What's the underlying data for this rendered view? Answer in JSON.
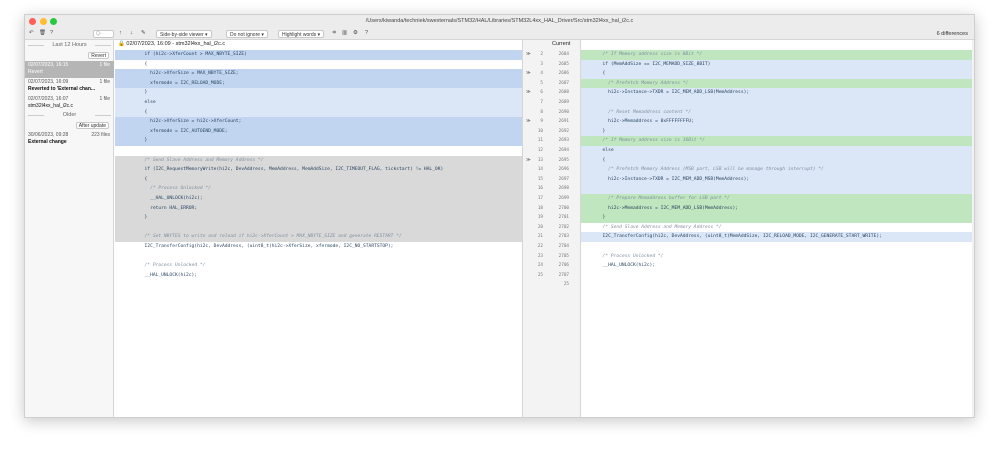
{
  "window": {
    "path": "/Users/kiwanda/techniek/swexternals/STM32/HAL/Libraries/STM32L4xx_HAL_Driver/Src/stm32l4xx_hal_i2c.c"
  },
  "toolbar": {
    "viewer": "Side-by-side viewer",
    "ignore": "Do not ignore",
    "highlight": "Highlight words",
    "search_placeholder": "Q-",
    "help": "?",
    "differences": "6 differences"
  },
  "sidebar": {
    "group_recent": "Last 12 Hours",
    "group_older": "Older",
    "revert_label": "Revert",
    "after_update_label": "After update",
    "entries": [
      {
        "date": "02/07/2023, 16:15",
        "files": "1 file",
        "message": "Revert"
      },
      {
        "date": "02/07/2023, 16:09",
        "files": "1 file",
        "message": "Reverted to 'External chan..."
      },
      {
        "date": "02/07/2023, 16:07",
        "files": "1 file",
        "message": "stm32l4xx_hal_i2c.c"
      },
      {
        "date": "30/06/2023, 09:28",
        "files": "223 files",
        "message": "External change"
      }
    ]
  },
  "left": {
    "header": "02/07/2023, 16:09 - stm32l4xx_hal_i2c.c",
    "lines": [
      "  if (hi2c->XferCount > MAX_NBYTE_SIZE)",
      "  {",
      "    hi2c->XferSize = MAX_NBYTE_SIZE;",
      "    xfermode = I2C_RELOAD_MODE;",
      "  }",
      "  else",
      "  {",
      "    hi2c->XferSize = hi2c->XferCount;",
      "    xfermode = I2C_AUTOEND_MODE;",
      "  }",
      "",
      "  /* Send Slave Address and Memory Address */",
      "  if (I2C_RequestMemoryWrite(hi2c, DevAddress, MemAddress, MemAddSize, I2C_TIMEOUT_FLAG, tickstart) != HAL_OK)",
      "  {",
      "    /* Process Unlocked */",
      "    __HAL_UNLOCK(hi2c);",
      "    return HAL_ERROR;",
      "  }",
      "",
      "  /* Set NBYTES to write and reload if hi2c->XferCount > MAX_NBYTE_SIZE and generate RESTART */",
      "  I2C_TransferConfig(hi2c, DevAddress, (uint8_t)hi2c->XferSize, xfermode, I2C_NO_STARTSTOP);",
      "",
      "  /* Process Unlocked */",
      "  __HAL_UNLOCK(hi2c);",
      ""
    ]
  },
  "gutter": {
    "header": "Current",
    "rows": [
      {
        "arrow": "≫",
        "left": "2",
        "right": "2684"
      },
      {
        "arrow": "",
        "left": "3",
        "right": "2685"
      },
      {
        "arrow": "≫",
        "left": "4",
        "right": "2686"
      },
      {
        "arrow": "",
        "left": "5",
        "right": "2687"
      },
      {
        "arrow": "≫",
        "left": "6",
        "right": "2688"
      },
      {
        "arrow": "",
        "left": "7",
        "right": "2689"
      },
      {
        "arrow": "",
        "left": "8",
        "right": "2690"
      },
      {
        "arrow": "≫",
        "left": "9",
        "right": "2691"
      },
      {
        "arrow": "",
        "left": "10",
        "right": "2692"
      },
      {
        "arrow": "",
        "left": "11",
        "right": "2693"
      },
      {
        "arrow": "",
        "left": "12",
        "right": "2694"
      },
      {
        "arrow": "≫",
        "left": "13",
        "right": "2695"
      },
      {
        "arrow": "",
        "left": "14",
        "right": "2696"
      },
      {
        "arrow": "",
        "left": "15",
        "right": "2697"
      },
      {
        "arrow": "",
        "left": "16",
        "right": "2698"
      },
      {
        "arrow": "",
        "left": "17",
        "right": "2699"
      },
      {
        "arrow": "",
        "left": "18",
        "right": "2700"
      },
      {
        "arrow": "",
        "left": "19",
        "right": "2701"
      },
      {
        "arrow": "",
        "left": "20",
        "right": "2702"
      },
      {
        "arrow": "",
        "left": "21",
        "right": "2703"
      },
      {
        "arrow": "",
        "left": "22",
        "right": "2704"
      },
      {
        "arrow": "",
        "left": "23",
        "right": "2705"
      },
      {
        "arrow": "",
        "left": "24",
        "right": "2706"
      },
      {
        "arrow": "",
        "left": "25",
        "right": "2707"
      },
      {
        "arrow": "",
        "left": "",
        "right": "25"
      }
    ]
  },
  "right": {
    "lines": [
      "  /* If Memory address size is 8Bit */",
      "  if (MemAddSize == I2C_MEMADD_SIZE_8BIT)",
      "  {",
      "    /* Prefetch Memory Address */",
      "    hi2c->Instance->TXDR = I2C_MEM_ADD_LSB(MemAddress);",
      "",
      "    /* Reset Memaddress content */",
      "    hi2c->Memaddress = 0xFFFFFFFFU;",
      "  }",
      "  /* If Memory address size is 16Bit */",
      "  else",
      "  {",
      "    /* Prefetch Memory Address (MSB part, LSB will be manage through interrupt) */",
      "    hi2c->Instance->TXDR = I2C_MEM_ADD_MSB(MemAddress);",
      "",
      "    /* Prepare Memaddress buffer for LSB part */",
      "    hi2c->Memaddress = I2C_MEM_ADD_LSB(MemAddress);",
      "  }",
      "  /* Send Slave Address and Memory Address */",
      "  I2C_TransferConfig(hi2c, DevAddress, (uint8_t)MemAddSize, I2C_RELOAD_MODE, I2C_GENERATE_START_WRITE);",
      "",
      "  /* Process Unlocked */",
      "  __HAL_UNLOCK(hi2c);",
      "",
      ""
    ]
  },
  "colors": {
    "changed_left": "#dbe6f6",
    "selected_left": "#c2d5f0",
    "deleted_left": "#d9d9d9",
    "changed_right": "#dbe6f6",
    "inserted_right": "#bfe6be"
  }
}
